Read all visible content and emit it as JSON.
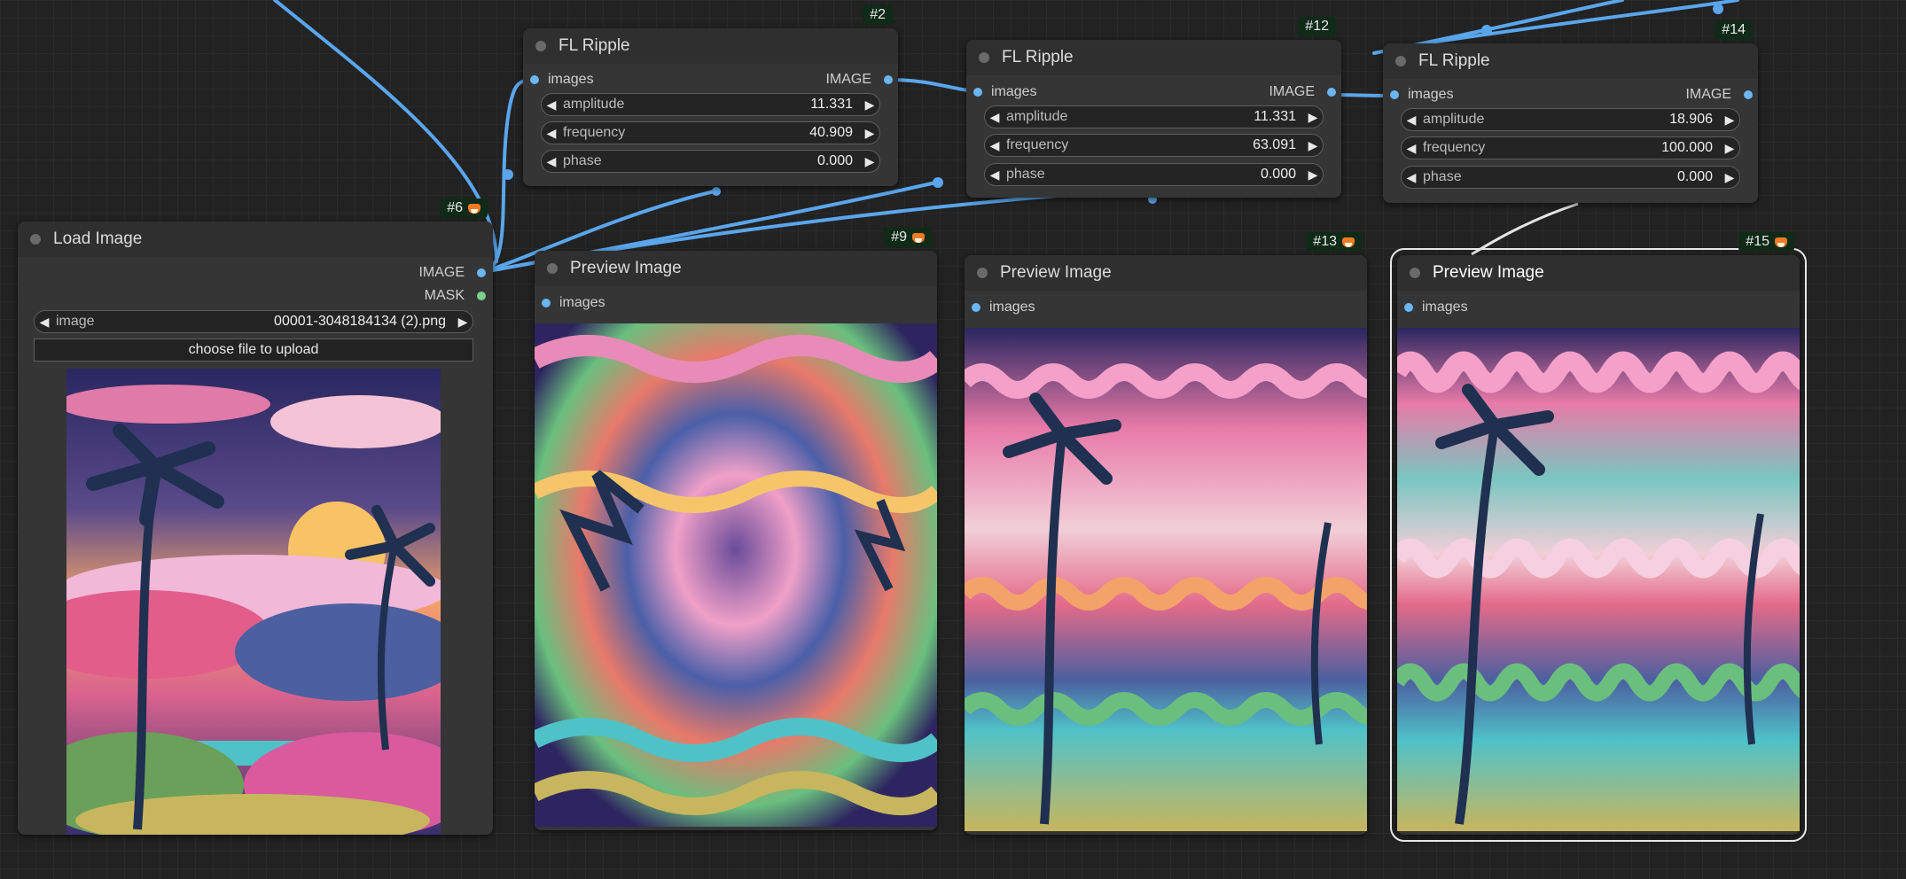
{
  "nodes": {
    "load_image": {
      "id": "#6",
      "title": "Load Image",
      "outputs": [
        "IMAGE",
        "MASK"
      ],
      "image_widget": {
        "label": "image",
        "value": "00001-3048184134 (2).png"
      },
      "upload_label": "choose file to upload"
    },
    "ripple_2": {
      "id": "#2",
      "title": "FL Ripple",
      "input": "images",
      "output": "IMAGE",
      "widgets": [
        {
          "label": "amplitude",
          "value": "11.331"
        },
        {
          "label": "frequency",
          "value": "40.909"
        },
        {
          "label": "phase",
          "value": "0.000"
        }
      ]
    },
    "ripple_12": {
      "id": "#12",
      "title": "FL Ripple",
      "input": "images",
      "output": "IMAGE",
      "widgets": [
        {
          "label": "amplitude",
          "value": "11.331"
        },
        {
          "label": "frequency",
          "value": "63.091"
        },
        {
          "label": "phase",
          "value": "0.000"
        }
      ]
    },
    "ripple_14": {
      "id": "#14",
      "title": "FL Ripple",
      "input": "images",
      "output": "IMAGE",
      "widgets": [
        {
          "label": "amplitude",
          "value": "18.906"
        },
        {
          "label": "frequency",
          "value": "100.000"
        },
        {
          "label": "phase",
          "value": "0.000"
        }
      ]
    },
    "preview_9": {
      "id": "#9",
      "title": "Preview Image",
      "input": "images"
    },
    "preview_13": {
      "id": "#13",
      "title": "Preview Image",
      "input": "images"
    },
    "preview_15": {
      "id": "#15",
      "title": "Preview Image",
      "input": "images"
    }
  },
  "colors": {
    "wire": "#5aa6ec",
    "canvas": "#222222",
    "node_body": "#353535",
    "badge": "#0f2a17"
  },
  "icons": {
    "node_collapse": "circle-dot-icon",
    "badge_logo": "fox-icon",
    "arrows": [
      "arrow-left-icon",
      "arrow-right-icon"
    ]
  }
}
